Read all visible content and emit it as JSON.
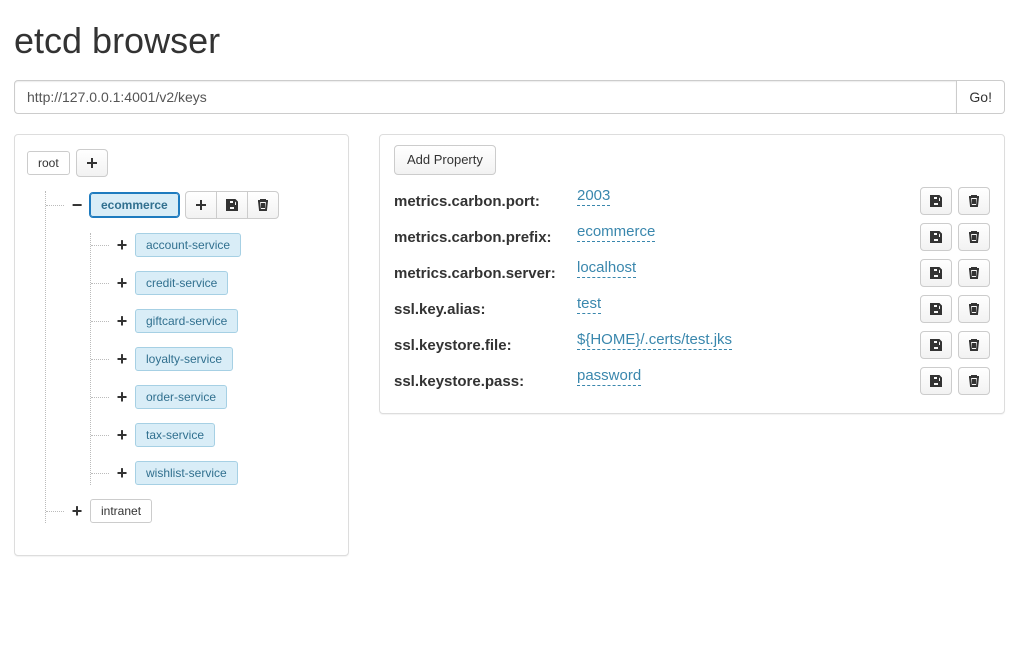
{
  "title": "etcd browser",
  "url_value": "http://127.0.0.1:4001/v2/keys",
  "go_label": "Go!",
  "tree": {
    "root_label": "root",
    "selected_label": "ecommerce",
    "services": [
      "account-service",
      "credit-service",
      "giftcard-service",
      "loyalty-service",
      "order-service",
      "tax-service",
      "wishlist-service"
    ],
    "sibling_label": "intranet"
  },
  "props_panel": {
    "add_label": "Add Property",
    "rows": [
      {
        "key": "metrics.carbon.port:",
        "value": "2003"
      },
      {
        "key": "metrics.carbon.prefix:",
        "value": "ecommerce"
      },
      {
        "key": "metrics.carbon.server:",
        "value": "localhost"
      },
      {
        "key": "ssl.key.alias:",
        "value": "test"
      },
      {
        "key": "ssl.keystore.file:",
        "value": "${HOME}/.certs/test.jks"
      },
      {
        "key": "ssl.keystore.pass:",
        "value": "password"
      }
    ]
  }
}
